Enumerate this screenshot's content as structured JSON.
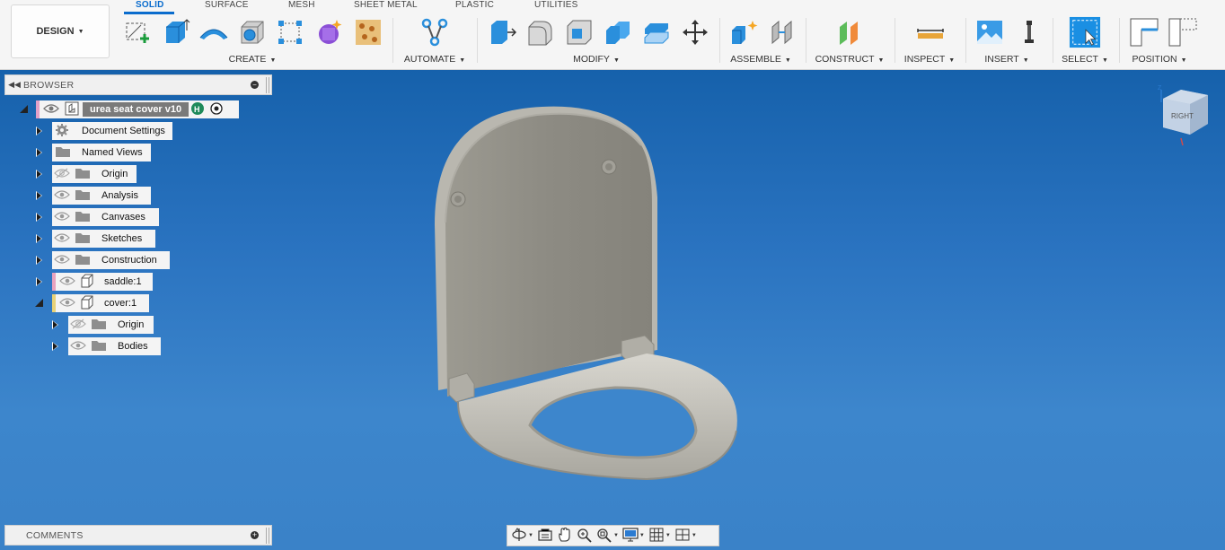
{
  "toolbar": {
    "design_label": "DESIGN",
    "tabs": [
      "SOLID",
      "SURFACE",
      "MESH",
      "SHEET METAL",
      "PLASTIC",
      "UTILITIES"
    ],
    "active_tab": "SOLID",
    "groups": [
      "CREATE",
      "AUTOMATE",
      "MODIFY",
      "ASSEMBLE",
      "CONSTRUCT",
      "INSPECT",
      "INSERT",
      "SELECT",
      "POSITION"
    ]
  },
  "browser": {
    "title": "BROWSER",
    "root": "urea seat cover v10",
    "items": [
      {
        "label": "Document Settings"
      },
      {
        "label": "Named Views"
      },
      {
        "label": "Origin"
      },
      {
        "label": "Analysis"
      },
      {
        "label": "Canvases"
      },
      {
        "label": "Sketches"
      },
      {
        "label": "Construction"
      },
      {
        "label": "saddle:1"
      },
      {
        "label": "cover:1"
      },
      {
        "label": "Origin"
      },
      {
        "label": "Bodies"
      }
    ]
  },
  "comments": {
    "title": "COMMENTS"
  },
  "viewcube": {
    "face": "RIGHT"
  },
  "colors": {
    "accent": "#0a6ccd",
    "viewport_top": "#0e5aa3",
    "viewport_bottom": "#3a82c8",
    "model": "#8f8d85"
  }
}
